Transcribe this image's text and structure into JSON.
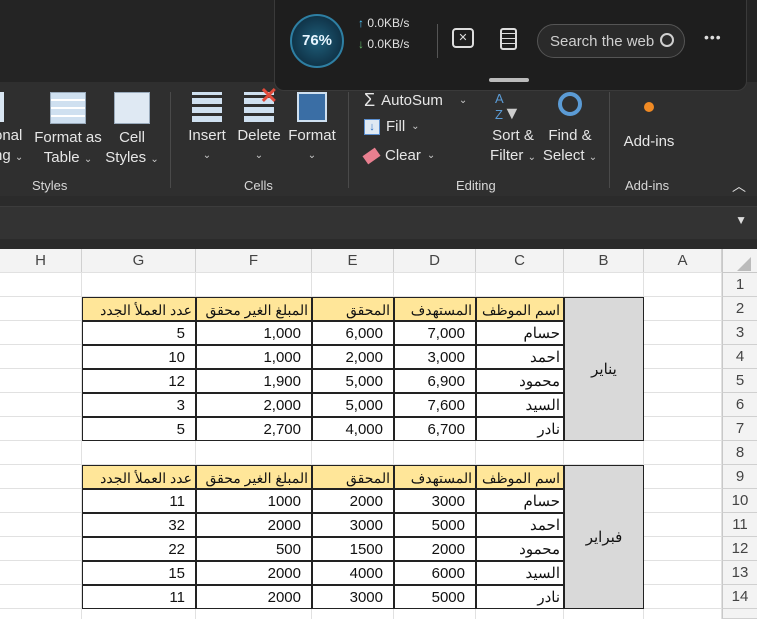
{
  "overlay": {
    "speed_value": "76%",
    "upload_speed": "0.0KB/s",
    "download_speed": "0.0KB/s",
    "search_placeholder": "Search the web",
    "more_label": "•••"
  },
  "ribbon": {
    "styles": {
      "conditional_line1": "onal",
      "conditional_line2": "ng",
      "format_as_table_line1": "Format as",
      "format_as_table_line2": "Table",
      "cell_styles_line1": "Cell",
      "cell_styles_line2": "Styles",
      "group_label": "Styles"
    },
    "cells": {
      "insert": "Insert",
      "delete": "Delete",
      "format": "Format",
      "group_label": "Cells"
    },
    "editing": {
      "autosum": "AutoSum",
      "fill": "Fill",
      "clear": "Clear",
      "sort_filter_line1": "Sort &",
      "sort_filter_line2": "Filter",
      "find_select_line1": "Find &",
      "find_select_line2": "Select",
      "group_label": "Editing"
    },
    "addins": {
      "label": "Add-ins",
      "group_label": "Add-ins"
    }
  },
  "sheet": {
    "columns": [
      "H",
      "G",
      "F",
      "E",
      "D",
      "C",
      "B",
      "A"
    ],
    "rows": [
      "1",
      "2",
      "3",
      "4",
      "5",
      "6",
      "7",
      "8",
      "9",
      "10",
      "11",
      "12",
      "13",
      "14"
    ],
    "headers": {
      "employee": "اسم الموظف",
      "target": "المستهدف",
      "achieved": "المحقق",
      "unachieved": "المبلغ الغير محقق",
      "new_clients": "عدد العملأ الجدد"
    },
    "table1": {
      "month": "يناير",
      "rows": [
        {
          "employee": "حسام",
          "target": "7,000",
          "achieved": "6,000",
          "unachieved": "1,000",
          "new_clients": "5"
        },
        {
          "employee": "احمد",
          "target": "3,000",
          "achieved": "2,000",
          "unachieved": "1,000",
          "new_clients": "10"
        },
        {
          "employee": "محمود",
          "target": "6,900",
          "achieved": "5,000",
          "unachieved": "1,900",
          "new_clients": "12"
        },
        {
          "employee": "السيد",
          "target": "7,600",
          "achieved": "5,000",
          "unachieved": "2,000",
          "new_clients": "3"
        },
        {
          "employee": "نادر",
          "target": "6,700",
          "achieved": "4,000",
          "unachieved": "2,700",
          "new_clients": "5"
        }
      ]
    },
    "table2": {
      "month": "فبراير",
      "rows": [
        {
          "employee": "حسام",
          "target": "3000",
          "achieved": "2000",
          "unachieved": "1000",
          "new_clients": "11"
        },
        {
          "employee": "احمد",
          "target": "5000",
          "achieved": "3000",
          "unachieved": "2000",
          "new_clients": "32"
        },
        {
          "employee": "محمود",
          "target": "2000",
          "achieved": "1500",
          "unachieved": "500",
          "new_clients": "22"
        },
        {
          "employee": "السيد",
          "target": "6000",
          "achieved": "4000",
          "unachieved": "2000",
          "new_clients": "15"
        },
        {
          "employee": "نادر",
          "target": "5000",
          "achieved": "3000",
          "unachieved": "2000",
          "new_clients": "11"
        }
      ]
    }
  },
  "colors": {
    "header_fill": "#ffe699",
    "month_fill": "#d9d9d9"
  }
}
